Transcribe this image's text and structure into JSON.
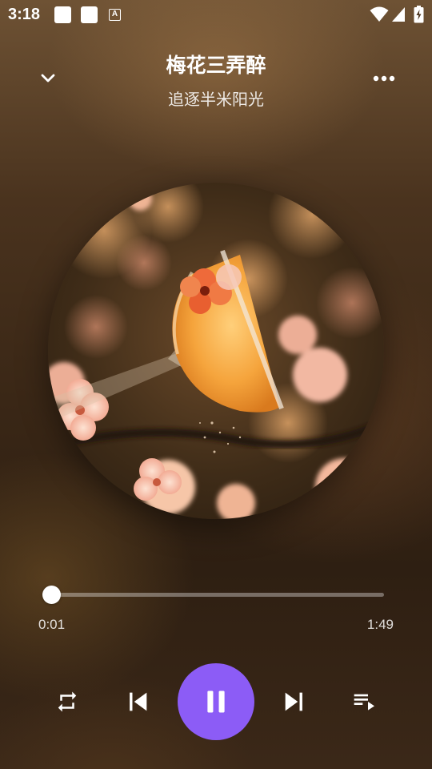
{
  "status_bar": {
    "time": "3:18",
    "notification_icon_label": "A"
  },
  "header": {
    "title": "梅花三弄醉",
    "artist": "追逐半米阳光"
  },
  "progress": {
    "current_time": "0:01",
    "total_time": "1:49",
    "fraction": 0.0
  },
  "controls": {
    "accent_color": "#8c5cf6",
    "icons": [
      "repeat-icon",
      "skip-previous-icon",
      "pause-icon",
      "skip-next-icon",
      "playlist-icon"
    ]
  }
}
